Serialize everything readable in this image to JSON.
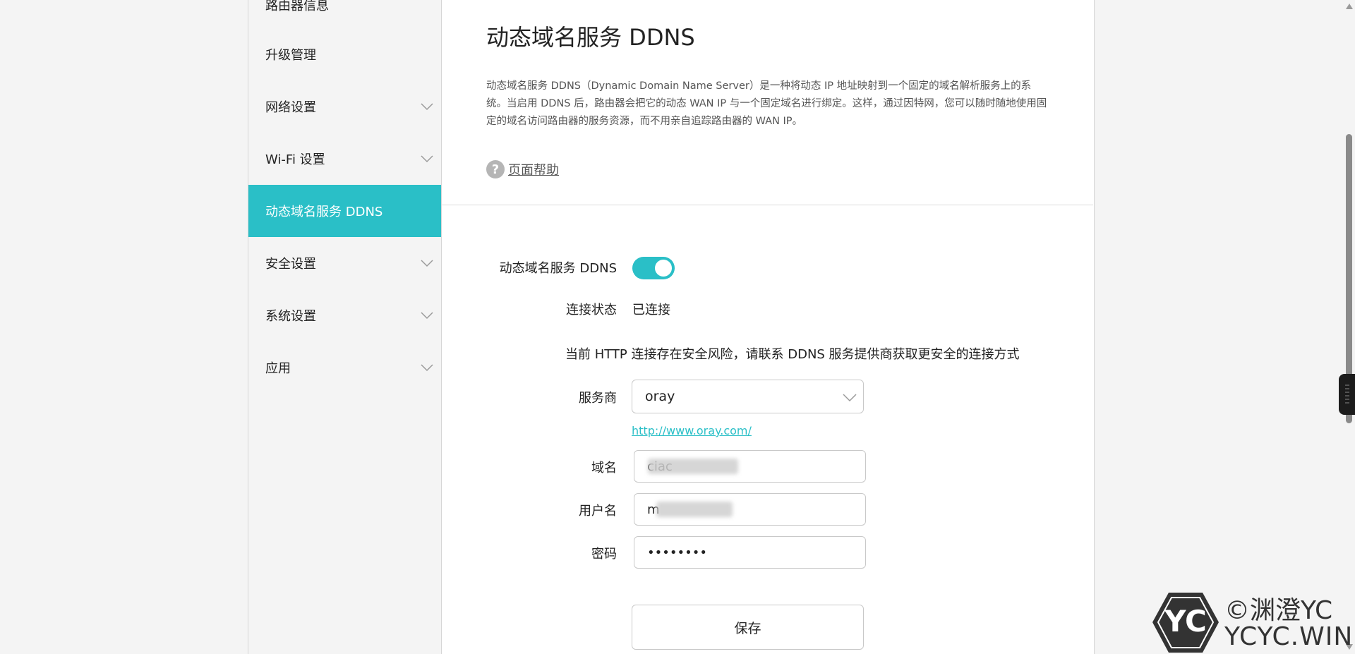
{
  "sidebar": {
    "items": [
      {
        "label": "路由器信息",
        "has_submenu": false,
        "active": false
      },
      {
        "label": "升级管理",
        "has_submenu": false,
        "active": false
      },
      {
        "label": "网络设置",
        "has_submenu": true,
        "active": false
      },
      {
        "label": "Wi-Fi 设置",
        "has_submenu": true,
        "active": false
      },
      {
        "label": "动态域名服务 DDNS",
        "has_submenu": false,
        "active": true
      },
      {
        "label": "安全设置",
        "has_submenu": true,
        "active": false
      },
      {
        "label": "系统设置",
        "has_submenu": true,
        "active": false
      },
      {
        "label": "应用",
        "has_submenu": true,
        "active": false
      }
    ]
  },
  "main": {
    "title": "动态域名服务 DDNS",
    "description": "动态域名服务 DDNS（Dynamic Domain Name Server）是一种将动态 IP 地址映射到一个固定的域名解析服务上的系统。当启用 DDNS 后，路由器会把它的动态 WAN IP 与一个固定域名进行绑定。这样，通过因特网，您可以随时随地使用固定的域名访问路由器的服务资源，而不用亲自追踪路由器的 WAN IP。",
    "help_label": "页面帮助",
    "help_icon": "?"
  },
  "form": {
    "ddns_label": "动态域名服务 DDNS",
    "ddns_enabled": true,
    "status_label": "连接状态",
    "status_value": "已连接",
    "warning": "当前 HTTP 连接存在安全风险，请联系 DDNS 服务提供商获取更安全的连接方式",
    "provider_label": "服务商",
    "provider_value": "oray",
    "provider_link": "http://www.oray.com/",
    "domain_label": "域名",
    "domain_value": "ciac",
    "username_label": "用户名",
    "username_value": "m",
    "password_label": "密码",
    "password_value": "••••••••",
    "save_label": "保存"
  },
  "watermark": {
    "logo_text": "YC",
    "line1": "©渊澄YC",
    "line2": "YCYC.WIN"
  },
  "colors": {
    "accent": "#2abfc7",
    "sidebar_bg": "#f4f4f4",
    "main_bg": "#ffffff"
  }
}
